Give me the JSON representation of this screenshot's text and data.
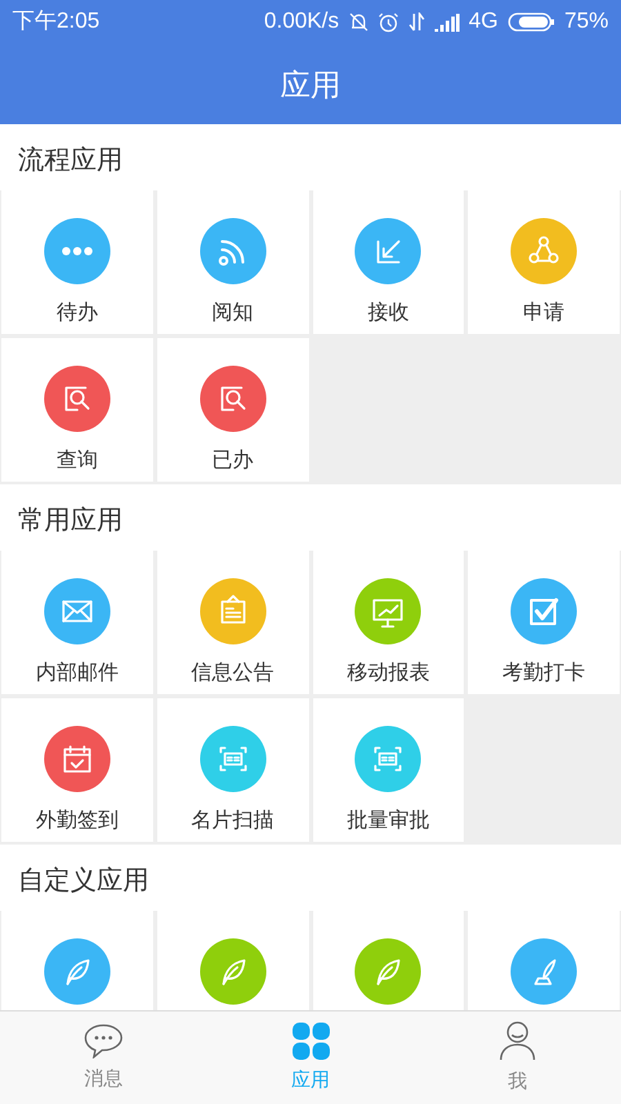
{
  "status_bar": {
    "time": "下午2:05",
    "speed": "0.00K/s",
    "network": "4G",
    "battery": "75%"
  },
  "header": {
    "title": "应用"
  },
  "sections": [
    {
      "title": "流程应用",
      "apps": [
        {
          "label": "待办",
          "kind": "dots",
          "color": "#3bb6f5"
        },
        {
          "label": "阅知",
          "kind": "rss",
          "color": "#3bb6f5"
        },
        {
          "label": "接收",
          "kind": "receive",
          "color": "#3bb6f5"
        },
        {
          "label": "申请",
          "kind": "share",
          "color": "#f2bd1f"
        },
        {
          "label": "查询",
          "kind": "search",
          "color": "#f05656"
        },
        {
          "label": "已办",
          "kind": "search",
          "color": "#f05656"
        }
      ]
    },
    {
      "title": "常用应用",
      "apps": [
        {
          "label": "内部邮件",
          "kind": "mail",
          "color": "#3bb6f5"
        },
        {
          "label": "信息公告",
          "kind": "notice",
          "color": "#f2bd1f"
        },
        {
          "label": "移动报表",
          "kind": "chart",
          "color": "#8fcf0c"
        },
        {
          "label": "考勤打卡",
          "kind": "check",
          "color": "#3bb6f5"
        },
        {
          "label": "外勤签到",
          "kind": "calendar",
          "color": "#f05656"
        },
        {
          "label": "名片扫描",
          "kind": "card",
          "color": "#2fcfe8"
        },
        {
          "label": "批量审批",
          "kind": "card",
          "color": "#2fcfe8"
        }
      ]
    },
    {
      "title": "自定义应用",
      "apps": [
        {
          "kind": "leaf",
          "color": "#3bb6f5"
        },
        {
          "kind": "leaf",
          "color": "#8fcf0c"
        },
        {
          "kind": "leaf",
          "color": "#8fcf0c"
        },
        {
          "kind": "quill",
          "color": "#3bb6f5"
        }
      ]
    }
  ],
  "tabs": [
    {
      "label": "消息",
      "kind": "chat",
      "selected": false
    },
    {
      "label": "应用",
      "kind": "grid",
      "selected": true
    },
    {
      "label": "我",
      "kind": "person",
      "selected": false
    }
  ]
}
